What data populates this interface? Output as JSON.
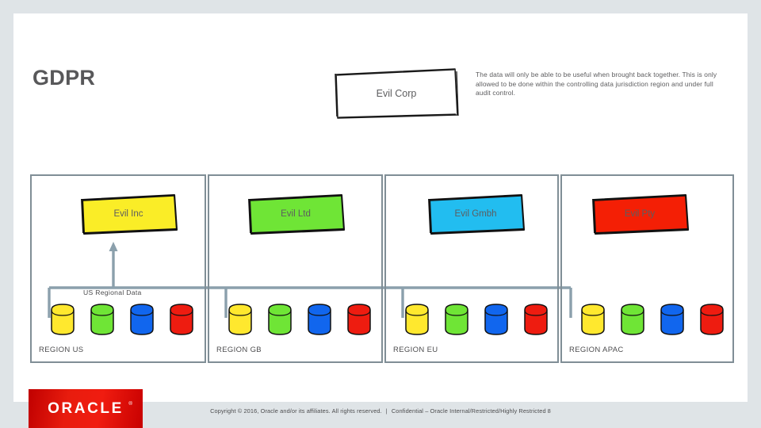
{
  "slide": {
    "title": "GDPR",
    "note": "The data will only be able to be useful when brought back together. This is only allowed to be done within the controlling data jurisdiction region and under full audit control.",
    "flow_label": "US Regional Data"
  },
  "parent": {
    "label": "Evil Corp",
    "fill": "#ffffff",
    "stroke": "#1a1a1a"
  },
  "regions": [
    {
      "id": "us",
      "region_label": "REGION US",
      "company": "Evil Inc",
      "company_fill": "#faed27",
      "databases": [
        {
          "name": "db-yellow",
          "color": "#ffe82e"
        },
        {
          "name": "db-green",
          "color": "#6fe536"
        },
        {
          "name": "db-blue",
          "color": "#1166ee"
        },
        {
          "name": "db-red",
          "color": "#ee1c10"
        }
      ]
    },
    {
      "id": "gb",
      "region_label": "REGION GB",
      "company": "Evil Ltd",
      "company_fill": "#6fe536",
      "databases": [
        {
          "name": "db-yellow",
          "color": "#ffe82e"
        },
        {
          "name": "db-green",
          "color": "#6fe536"
        },
        {
          "name": "db-blue",
          "color": "#1166ee"
        },
        {
          "name": "db-red",
          "color": "#ee1c10"
        }
      ]
    },
    {
      "id": "eu",
      "region_label": "REGION EU",
      "company": "Evil Gmbh",
      "company_fill": "#22bdf0",
      "databases": [
        {
          "name": "db-yellow",
          "color": "#ffe82e"
        },
        {
          "name": "db-green",
          "color": "#6fe536"
        },
        {
          "name": "db-blue",
          "color": "#1166ee"
        },
        {
          "name": "db-red",
          "color": "#ee1c10"
        }
      ]
    },
    {
      "id": "apac",
      "region_label": "REGION APAC",
      "company": "Evil Pty",
      "company_fill": "#f41f05",
      "databases": [
        {
          "name": "db-yellow",
          "color": "#ffe82e"
        },
        {
          "name": "db-green",
          "color": "#6fe536"
        },
        {
          "name": "db-blue",
          "color": "#1166ee"
        },
        {
          "name": "db-red",
          "color": "#ee1c10"
        }
      ]
    }
  ],
  "footer": {
    "logo_text": "ORACLE",
    "logo_tm": "®",
    "logo_color": "#ee1c10",
    "copyright": "Copyright © 2016, Oracle and/or its affiliates. All rights reserved.",
    "separator": "|",
    "classification": "Confidential – Oracle Internal/Restricted/Highly Restricted",
    "page_number": "8"
  },
  "colors": {
    "panel_border": "#808e96",
    "connector": "#8ba0ac",
    "page_background": "#dfe4e7",
    "slide_background": "#ffffff",
    "text": "#4d4d4f"
  }
}
